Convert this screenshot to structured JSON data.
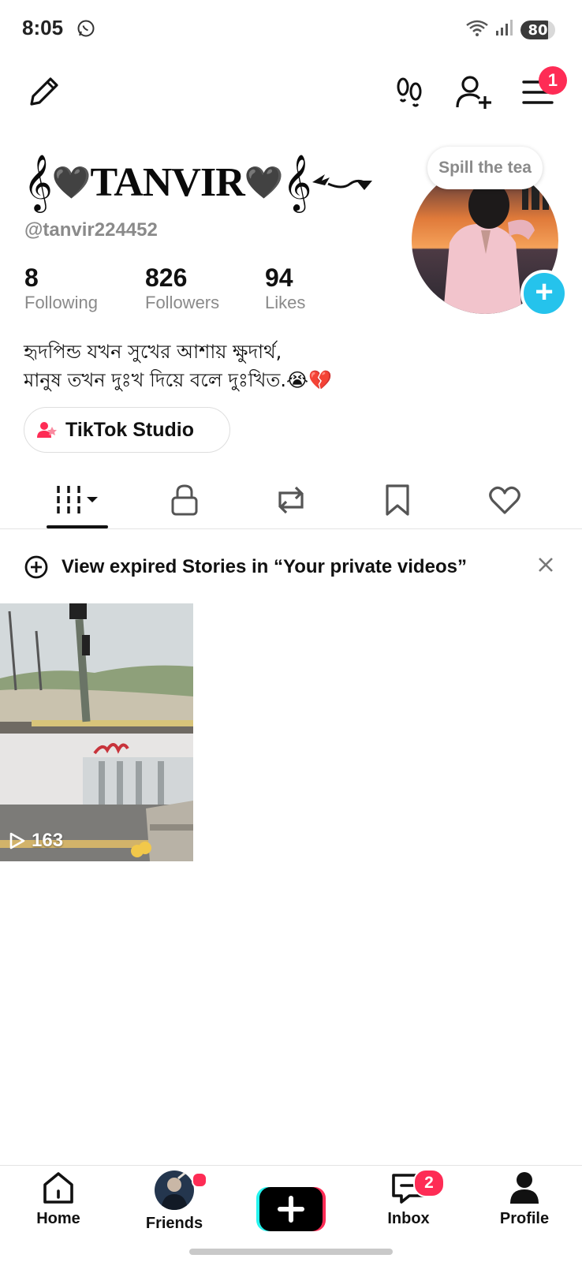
{
  "status_bar": {
    "time": "8:05",
    "battery": "80",
    "battery_level": 0.8,
    "messaging_icon": "whatsapp-icon",
    "wifi_icon": "wifi-icon",
    "signal_icon": "signal-icon"
  },
  "top_bar": {
    "edit_icon": "pencil-icon",
    "footprint_icon": "footprints-icon",
    "add_friend_icon": "add-user-icon",
    "menu_icon": "hamburger-icon",
    "menu_badge": "1"
  },
  "profile": {
    "display_name_text": "TANVIR",
    "display_name_emoji": "🖤",
    "username": "@tanvir224452",
    "avatar_bubble": "Spill the tea",
    "stats": [
      {
        "value": "8",
        "label": "Following"
      },
      {
        "value": "826",
        "label": "Followers"
      },
      {
        "value": "94",
        "label": "Likes"
      }
    ],
    "bio_line1": "হৃদপিন্ড যখন সুখের আশায় ক্ষুদার্থ,",
    "bio_line2": "মানুষ তখন দুঃখ দিয়ে বলে দুঃখিত.😭💔",
    "studio_button": "TikTok Studio"
  },
  "tabs": [
    "videos-grid-icon",
    "lock-icon",
    "repost-icon",
    "bookmark-icon",
    "heart-icon"
  ],
  "notice": {
    "text": "View expired Stories in “Your private videos”",
    "icon": "story-plus-icon"
  },
  "videos": [
    {
      "views": "163"
    }
  ],
  "bottom_nav": {
    "home": "Home",
    "friends": "Friends",
    "inbox": "Inbox",
    "inbox_badge": "2",
    "profile": "Profile"
  },
  "colors": {
    "accent_red": "#fe2c55",
    "accent_cyan": "#25c3ec",
    "muted_text": "#8a8a8a"
  }
}
